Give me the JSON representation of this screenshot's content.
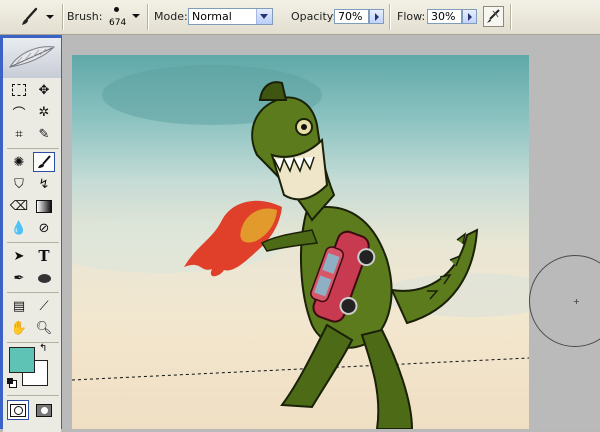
{
  "options_bar": {
    "brush_label": "Brush:",
    "brush_size": "674",
    "mode_label": "Mode:",
    "mode_value": "Normal",
    "opacity_label": "Opacity:",
    "opacity_value": "70%",
    "flow_label": "Flow:",
    "flow_value": "30%"
  },
  "tools_panel": {
    "active_tool": "brush-tool",
    "foreground_color": "#5ec2b5",
    "background_color": "#ffffff"
  },
  "canvas": {
    "creature_color": "#5b7b1c",
    "car_color": "#c83a4f",
    "flame_color": "#e0402a"
  }
}
